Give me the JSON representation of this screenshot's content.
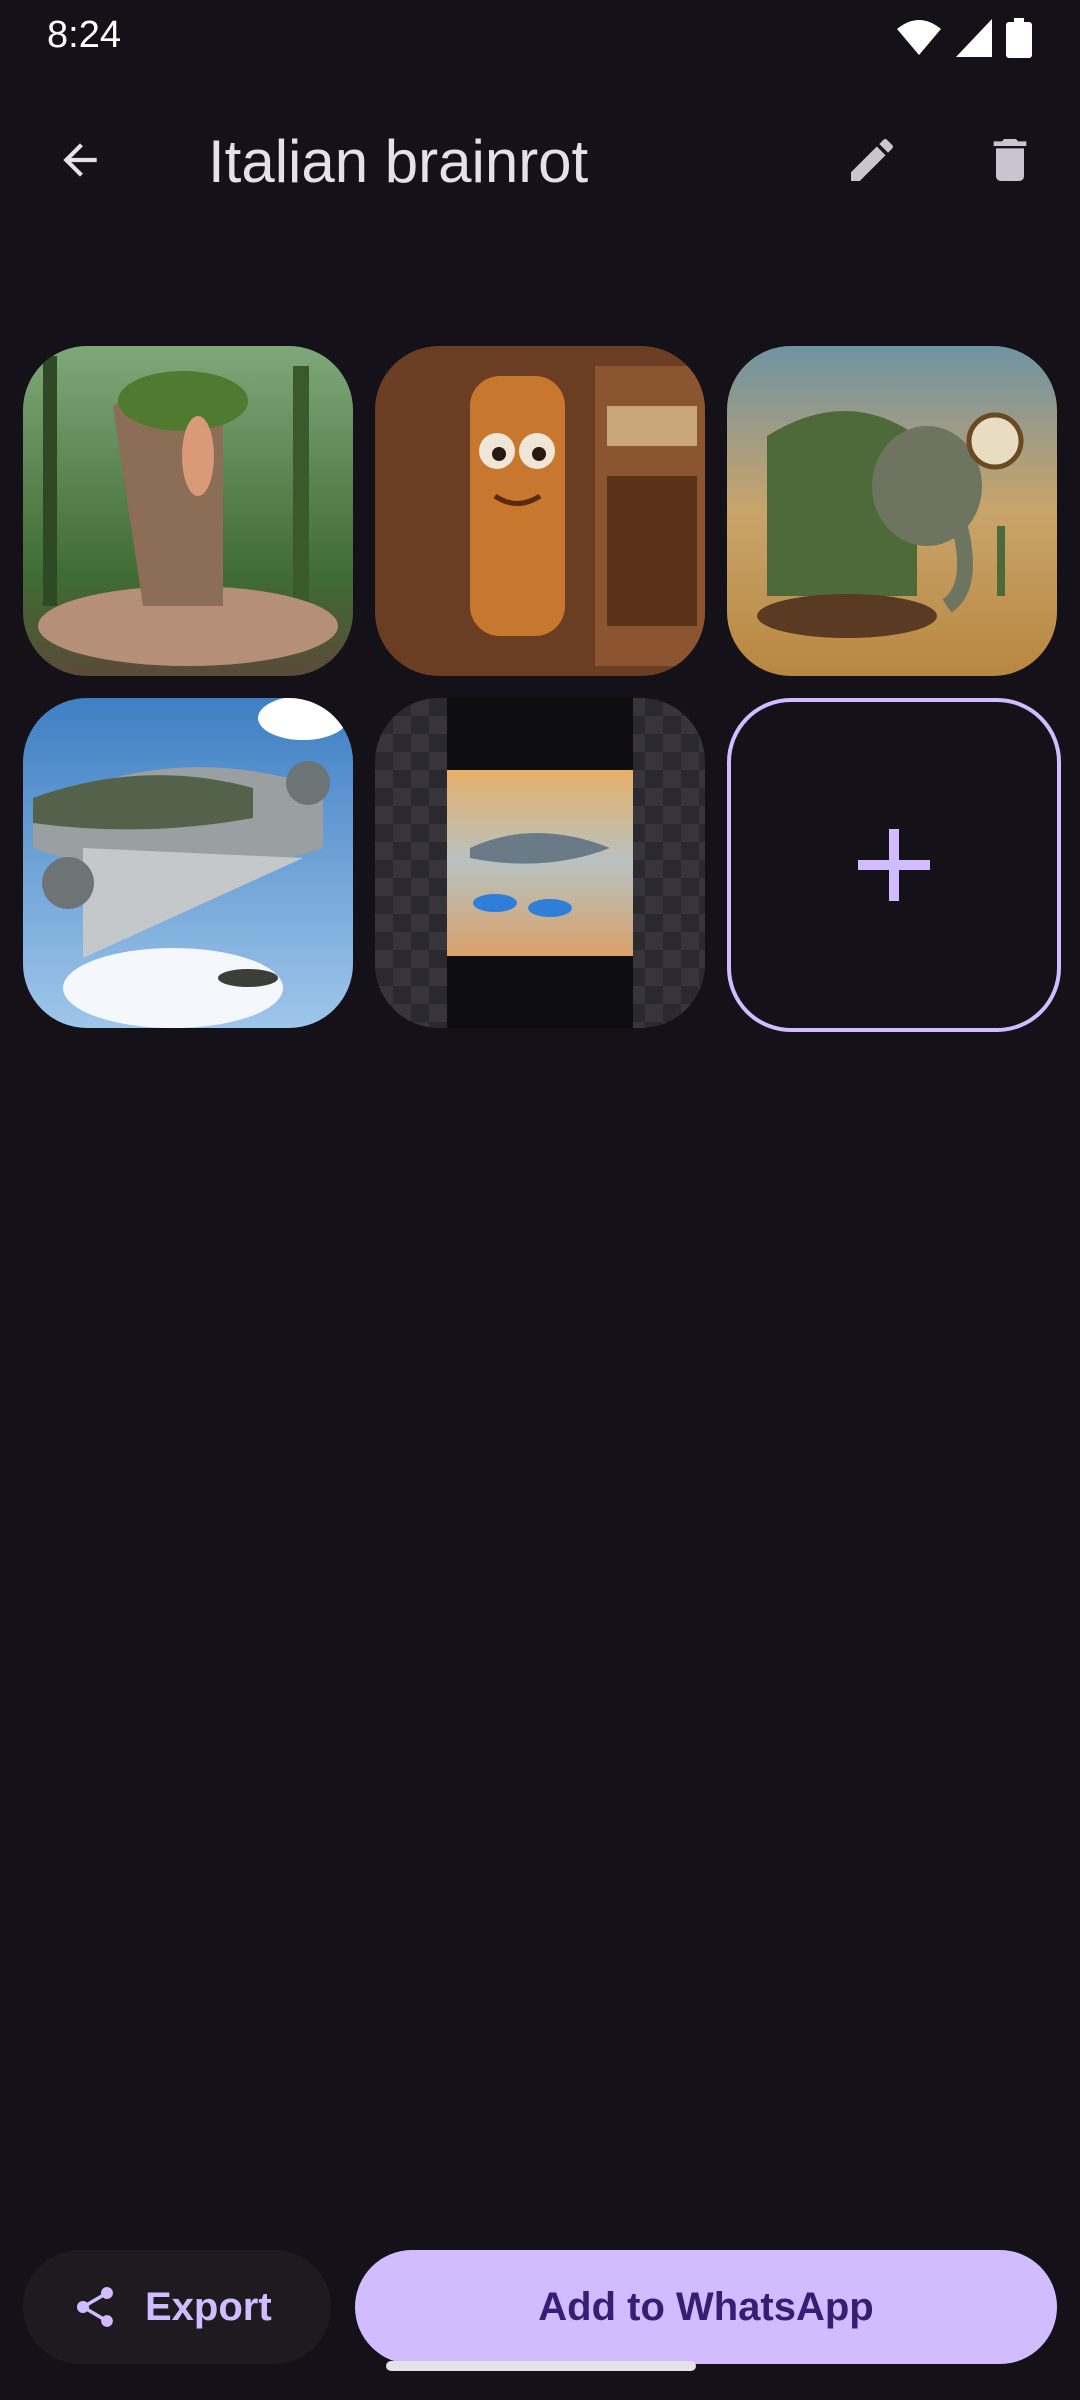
{
  "status_bar": {
    "time": "8:24",
    "icons": [
      "wifi-icon",
      "cellular-signal-icon",
      "battery-icon"
    ]
  },
  "app_bar": {
    "title": "Italian brainrot",
    "back_icon": "arrow-back-icon",
    "edit_icon": "pencil-icon",
    "delete_icon": "trash-icon"
  },
  "stickers": [
    {
      "id": "sticker-1",
      "depiction": "tree-feet creature"
    },
    {
      "id": "sticker-2",
      "depiction": "wooden bat character"
    },
    {
      "id": "sticker-3",
      "depiction": "cactus elephant"
    },
    {
      "id": "sticker-4",
      "depiction": "crocodile airplane"
    },
    {
      "id": "sticker-5",
      "depiction": "shark with sneakers"
    }
  ],
  "add_tile_icon": "plus-icon",
  "actions": {
    "export_label": "Export",
    "export_icon": "share-icon",
    "whatsapp_label": "Add to WhatsApp"
  },
  "colors": {
    "background": "#141218",
    "accent": "#d0bcff",
    "on_accent": "#381e72",
    "surface": "#1d1b20"
  }
}
